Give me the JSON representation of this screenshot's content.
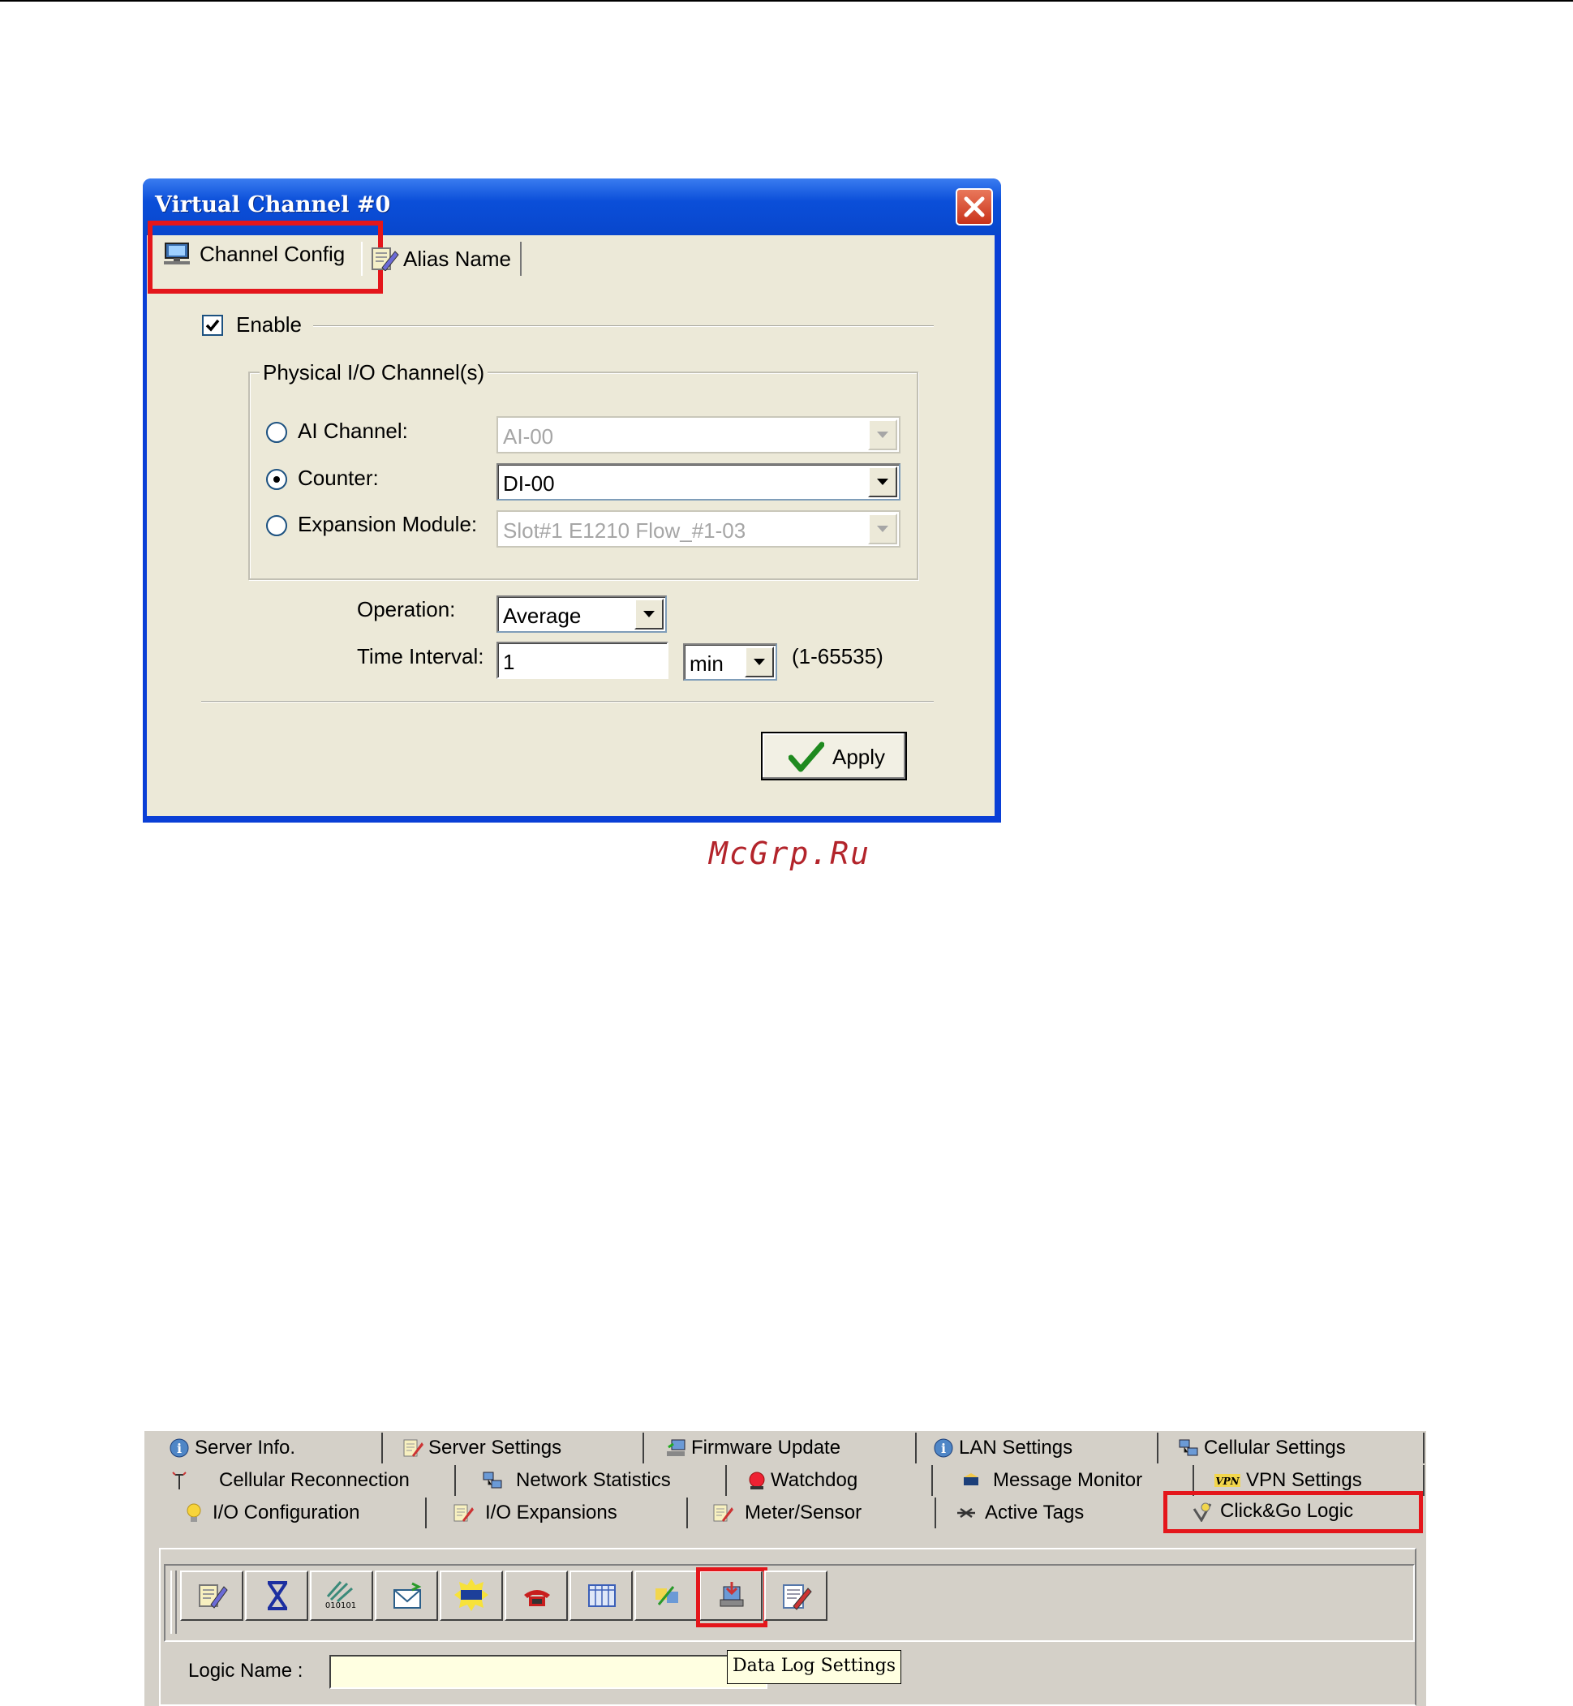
{
  "dialog": {
    "title": "Virtual Channel #0",
    "tabs": [
      {
        "label": "Channel Config",
        "icon": "monitor-config-icon",
        "active": true
      },
      {
        "label": "Alias Name",
        "icon": "notepad-edit-icon",
        "active": false
      }
    ],
    "enable": {
      "label": "Enable",
      "checked": true
    },
    "group": {
      "title": "Physical I/O Channel(s)",
      "options": [
        {
          "label": "AI Channel:",
          "selected": false,
          "value": "AI-00",
          "enabled": false
        },
        {
          "label": "Counter:",
          "selected": true,
          "value": "DI-00",
          "enabled": true
        },
        {
          "label": "Expansion Module:",
          "selected": false,
          "value": "Slot#1 E1210 Flow_#1-03",
          "enabled": false
        }
      ]
    },
    "operation": {
      "label": "Operation:",
      "value": "Average"
    },
    "time_interval": {
      "label": "Time Interval:",
      "value": "1",
      "unit": "min",
      "range": "(1-65535)"
    },
    "apply_label": "Apply"
  },
  "watermark": "McGrp.Ru",
  "panel": {
    "tab_rows": [
      [
        {
          "label": "Server Info.",
          "icon": "info-icon"
        },
        {
          "label": "Server Settings",
          "icon": "notepad-edit-icon"
        },
        {
          "label": "Firmware Update",
          "icon": "network-update-icon"
        },
        {
          "label": "LAN Settings",
          "icon": "info-icon"
        },
        {
          "label": "Cellular Settings",
          "icon": "network-computers-icon"
        }
      ],
      [
        {
          "label": "Cellular Reconnection",
          "icon": "antenna-icon"
        },
        {
          "label": "Network Statistics",
          "icon": "network-computers-icon"
        },
        {
          "label": "Watchdog",
          "icon": "alarm-light-icon"
        },
        {
          "label": "Message Monitor",
          "icon": "message-icon"
        },
        {
          "label": "VPN Settings",
          "icon": "vpn-icon"
        }
      ],
      [
        {
          "label": "I/O Configuration",
          "icon": "lightbulb-icon"
        },
        {
          "label": "I/O Expansions",
          "icon": "notepad-edit-icon"
        },
        {
          "label": "Meter/Sensor",
          "icon": "notepad-edit-icon"
        },
        {
          "label": "Active Tags",
          "icon": "active-tags-icon"
        },
        {
          "label": "Click&Go Logic",
          "icon": "logic-icon",
          "active": true
        }
      ]
    ],
    "toolbar_buttons": [
      {
        "icon": "edit-icon"
      },
      {
        "icon": "hourglass-icon"
      },
      {
        "icon": "binary-signal-icon"
      },
      {
        "icon": "email-icon"
      },
      {
        "icon": "snmp-trap-icon"
      },
      {
        "icon": "phone-icon"
      },
      {
        "icon": "table-icon"
      },
      {
        "icon": "swap-icon"
      },
      {
        "icon": "data-log-icon",
        "highlighted": true
      },
      {
        "icon": "edit-document-icon"
      }
    ],
    "logic_name": {
      "label": "Logic Name :",
      "value": ""
    },
    "tooltip": "Data Log Settings"
  }
}
